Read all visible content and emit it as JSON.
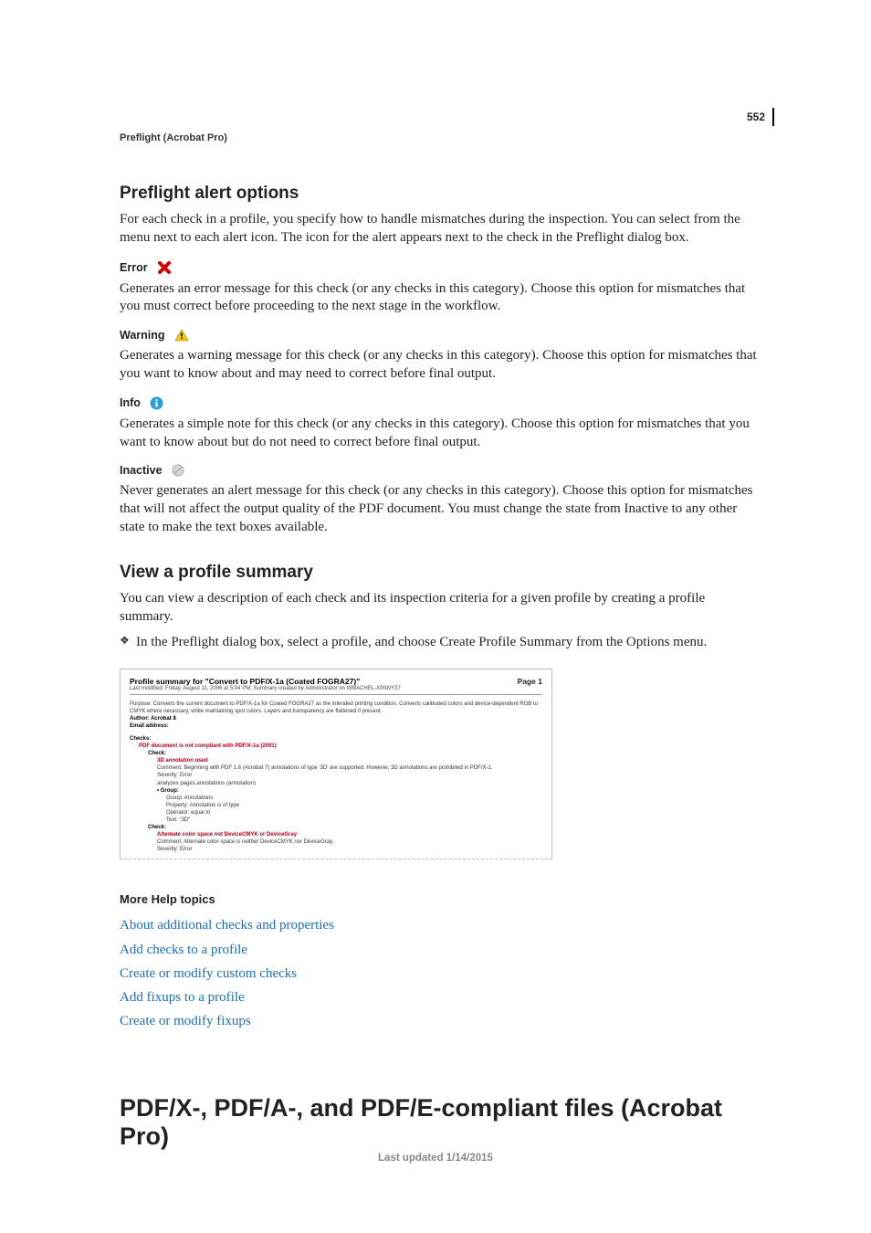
{
  "page_number": "552",
  "running_head": "Preflight (Acrobat Pro)",
  "section1": {
    "heading": "Preflight alert options",
    "intro": "For each check in a profile, you specify how to handle mismatches during the inspection. You can select from the menu next to each alert icon. The icon for the alert appears next to the check in the Preflight dialog box.",
    "options": {
      "error": {
        "label": "Error",
        "desc": "Generates an error message for this check (or any checks in this category). Choose this option for mismatches that you must correct before proceeding to the next stage in the workflow."
      },
      "warning": {
        "label": "Warning",
        "desc": "Generates a warning message for this check (or any checks in this category). Choose this option for mismatches that you want to know about and may need to correct before final output."
      },
      "info": {
        "label": "Info",
        "desc": "Generates a simple note for this check (or any checks in this category). Choose this option for mismatches that you want to know about but do not need to correct before final output."
      },
      "inactive": {
        "label": "Inactive",
        "desc": "Never generates an alert message for this check (or any checks in this category). Choose this option for mismatches that will not affect the output quality of the PDF document. You must change the state from Inactive to any other state to make the text boxes available."
      }
    }
  },
  "section2": {
    "heading": "View a profile summary",
    "intro": "You can view a description of each check and its inspection criteria for a given profile by creating a profile summary.",
    "bullet": "In the Preflight dialog box, select a profile, and choose Create Profile Summary from the Options menu."
  },
  "figure": {
    "title": "Profile summary for \"Convert to PDF/X-1a (Coated FOGRA27)\"",
    "page": "Page 1",
    "subtitle": "Last modified: Friday, August 11, 2006 at 5:04 PM; Summary created by Administrator on WMACHEL-XPANY37",
    "purpose": "Purpose: Converts the current document to PDF/X-1a for Coated FOGRA27 as the intended printing condition. Converts calibrated colors and device-dependent RGB to CMYK where necessary, while maintaining spot colors. Layers and transparency are flattened if present.",
    "author": "Author: Acrobat 8",
    "email": "Email address:",
    "checks_label": "Checks:",
    "pdf_not": "PDF document is not compliant with PDF/X-1a (2001)",
    "check_label": "Check:",
    "ann3d": "3D annotation used",
    "ann3d_comment": "Comment: Beginning with PDF 1.6 (Acrobat 7) annotations of type '3D' are supported. However, 3D annotations are prohibited in PDF/X-1.",
    "sev_err": "Severity: Error",
    "analyzes": "analyzes pages annotations (annotation)",
    "group_label": "• Group:",
    "group_ann": "Group: Annotations",
    "prop": "Property: Annotation is of type",
    "op": "Operator: equal to",
    "text3d": "Text: \"3D\"",
    "alt": "Alternate color space not DeviceCMYK or DeviceGray",
    "alt_comment": "Comment: Alternate color space is neither DeviceCMYK nor DeviceGray."
  },
  "more_help": {
    "heading": "More Help topics",
    "links": [
      "About additional checks and properties",
      "Add checks to a profile",
      "Create or modify custom checks",
      "Add fixups to a profile",
      "Create or modify fixups"
    ]
  },
  "big_heading": "PDF/X-, PDF/A-, and PDF/E-compliant files (Acrobat Pro)",
  "footer": "Last updated 1/14/2015"
}
